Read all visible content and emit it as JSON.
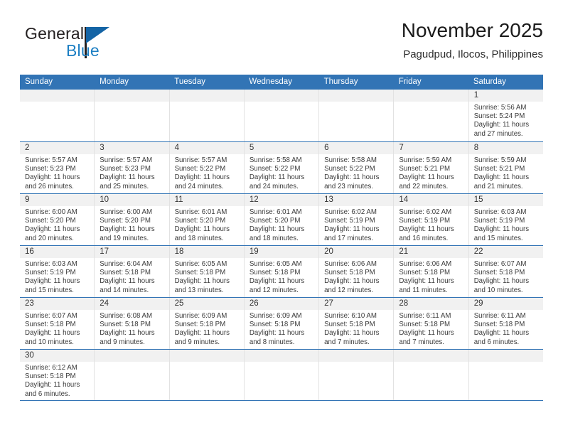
{
  "brand": {
    "name_part1": "General",
    "name_part2": "Blue",
    "triangle_color": "#1464a5",
    "blue_text_color": "#1d7fc3"
  },
  "header": {
    "title": "November 2025",
    "subtitle": "Pagudpud, Ilocos, Philippines"
  },
  "theme": {
    "header_blue": "#3274b5",
    "daynum_band": "#f1f1f1",
    "cell_border": "#e2e2e2"
  },
  "weekdays": [
    "Sunday",
    "Monday",
    "Tuesday",
    "Wednesday",
    "Thursday",
    "Friday",
    "Saturday"
  ],
  "weeks": [
    {
      "days": [
        {
          "blank": true
        },
        {
          "blank": true
        },
        {
          "blank": true
        },
        {
          "blank": true
        },
        {
          "blank": true
        },
        {
          "blank": true
        },
        {
          "blank": false,
          "num": "1",
          "sunrise": "Sunrise: 5:56 AM",
          "sunset": "Sunset: 5:24 PM",
          "daylight": "Daylight: 11 hours and 27 minutes."
        }
      ]
    },
    {
      "days": [
        {
          "blank": false,
          "num": "2",
          "sunrise": "Sunrise: 5:57 AM",
          "sunset": "Sunset: 5:23 PM",
          "daylight": "Daylight: 11 hours and 26 minutes."
        },
        {
          "blank": false,
          "num": "3",
          "sunrise": "Sunrise: 5:57 AM",
          "sunset": "Sunset: 5:23 PM",
          "daylight": "Daylight: 11 hours and 25 minutes."
        },
        {
          "blank": false,
          "num": "4",
          "sunrise": "Sunrise: 5:57 AM",
          "sunset": "Sunset: 5:22 PM",
          "daylight": "Daylight: 11 hours and 24 minutes."
        },
        {
          "blank": false,
          "num": "5",
          "sunrise": "Sunrise: 5:58 AM",
          "sunset": "Sunset: 5:22 PM",
          "daylight": "Daylight: 11 hours and 24 minutes."
        },
        {
          "blank": false,
          "num": "6",
          "sunrise": "Sunrise: 5:58 AM",
          "sunset": "Sunset: 5:22 PM",
          "daylight": "Daylight: 11 hours and 23 minutes."
        },
        {
          "blank": false,
          "num": "7",
          "sunrise": "Sunrise: 5:59 AM",
          "sunset": "Sunset: 5:21 PM",
          "daylight": "Daylight: 11 hours and 22 minutes."
        },
        {
          "blank": false,
          "num": "8",
          "sunrise": "Sunrise: 5:59 AM",
          "sunset": "Sunset: 5:21 PM",
          "daylight": "Daylight: 11 hours and 21 minutes."
        }
      ]
    },
    {
      "days": [
        {
          "blank": false,
          "num": "9",
          "sunrise": "Sunrise: 6:00 AM",
          "sunset": "Sunset: 5:20 PM",
          "daylight": "Daylight: 11 hours and 20 minutes."
        },
        {
          "blank": false,
          "num": "10",
          "sunrise": "Sunrise: 6:00 AM",
          "sunset": "Sunset: 5:20 PM",
          "daylight": "Daylight: 11 hours and 19 minutes."
        },
        {
          "blank": false,
          "num": "11",
          "sunrise": "Sunrise: 6:01 AM",
          "sunset": "Sunset: 5:20 PM",
          "daylight": "Daylight: 11 hours and 18 minutes."
        },
        {
          "blank": false,
          "num": "12",
          "sunrise": "Sunrise: 6:01 AM",
          "sunset": "Sunset: 5:20 PM",
          "daylight": "Daylight: 11 hours and 18 minutes."
        },
        {
          "blank": false,
          "num": "13",
          "sunrise": "Sunrise: 6:02 AM",
          "sunset": "Sunset: 5:19 PM",
          "daylight": "Daylight: 11 hours and 17 minutes."
        },
        {
          "blank": false,
          "num": "14",
          "sunrise": "Sunrise: 6:02 AM",
          "sunset": "Sunset: 5:19 PM",
          "daylight": "Daylight: 11 hours and 16 minutes."
        },
        {
          "blank": false,
          "num": "15",
          "sunrise": "Sunrise: 6:03 AM",
          "sunset": "Sunset: 5:19 PM",
          "daylight": "Daylight: 11 hours and 15 minutes."
        }
      ]
    },
    {
      "days": [
        {
          "blank": false,
          "num": "16",
          "sunrise": "Sunrise: 6:03 AM",
          "sunset": "Sunset: 5:19 PM",
          "daylight": "Daylight: 11 hours and 15 minutes."
        },
        {
          "blank": false,
          "num": "17",
          "sunrise": "Sunrise: 6:04 AM",
          "sunset": "Sunset: 5:18 PM",
          "daylight": "Daylight: 11 hours and 14 minutes."
        },
        {
          "blank": false,
          "num": "18",
          "sunrise": "Sunrise: 6:05 AM",
          "sunset": "Sunset: 5:18 PM",
          "daylight": "Daylight: 11 hours and 13 minutes."
        },
        {
          "blank": false,
          "num": "19",
          "sunrise": "Sunrise: 6:05 AM",
          "sunset": "Sunset: 5:18 PM",
          "daylight": "Daylight: 11 hours and 12 minutes."
        },
        {
          "blank": false,
          "num": "20",
          "sunrise": "Sunrise: 6:06 AM",
          "sunset": "Sunset: 5:18 PM",
          "daylight": "Daylight: 11 hours and 12 minutes."
        },
        {
          "blank": false,
          "num": "21",
          "sunrise": "Sunrise: 6:06 AM",
          "sunset": "Sunset: 5:18 PM",
          "daylight": "Daylight: 11 hours and 11 minutes."
        },
        {
          "blank": false,
          "num": "22",
          "sunrise": "Sunrise: 6:07 AM",
          "sunset": "Sunset: 5:18 PM",
          "daylight": "Daylight: 11 hours and 10 minutes."
        }
      ]
    },
    {
      "days": [
        {
          "blank": false,
          "num": "23",
          "sunrise": "Sunrise: 6:07 AM",
          "sunset": "Sunset: 5:18 PM",
          "daylight": "Daylight: 11 hours and 10 minutes."
        },
        {
          "blank": false,
          "num": "24",
          "sunrise": "Sunrise: 6:08 AM",
          "sunset": "Sunset: 5:18 PM",
          "daylight": "Daylight: 11 hours and 9 minutes."
        },
        {
          "blank": false,
          "num": "25",
          "sunrise": "Sunrise: 6:09 AM",
          "sunset": "Sunset: 5:18 PM",
          "daylight": "Daylight: 11 hours and 9 minutes."
        },
        {
          "blank": false,
          "num": "26",
          "sunrise": "Sunrise: 6:09 AM",
          "sunset": "Sunset: 5:18 PM",
          "daylight": "Daylight: 11 hours and 8 minutes."
        },
        {
          "blank": false,
          "num": "27",
          "sunrise": "Sunrise: 6:10 AM",
          "sunset": "Sunset: 5:18 PM",
          "daylight": "Daylight: 11 hours and 7 minutes."
        },
        {
          "blank": false,
          "num": "28",
          "sunrise": "Sunrise: 6:11 AM",
          "sunset": "Sunset: 5:18 PM",
          "daylight": "Daylight: 11 hours and 7 minutes."
        },
        {
          "blank": false,
          "num": "29",
          "sunrise": "Sunrise: 6:11 AM",
          "sunset": "Sunset: 5:18 PM",
          "daylight": "Daylight: 11 hours and 6 minutes."
        }
      ]
    },
    {
      "days": [
        {
          "blank": false,
          "num": "30",
          "sunrise": "Sunrise: 6:12 AM",
          "sunset": "Sunset: 5:18 PM",
          "daylight": "Daylight: 11 hours and 6 minutes."
        },
        {
          "blank": true
        },
        {
          "blank": true
        },
        {
          "blank": true
        },
        {
          "blank": true
        },
        {
          "blank": true
        },
        {
          "blank": true
        }
      ]
    }
  ]
}
